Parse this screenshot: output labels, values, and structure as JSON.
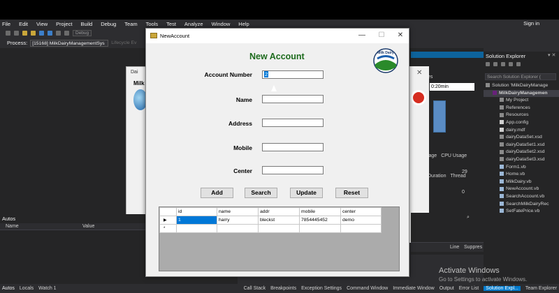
{
  "menu": [
    "File",
    "Edit",
    "View",
    "Project",
    "Build",
    "Debug",
    "Team",
    "Tools",
    "Test",
    "Analyze",
    "Window",
    "Help"
  ],
  "sign_in": "Sign in",
  "toolbar": {
    "debug_combo": "Debug"
  },
  "process": {
    "label": "Process:",
    "value": "[15168] MilkDairyManagementSys",
    "lifecycle": "Lifecycle Ev"
  },
  "bg_dialog": {
    "title": "Dai",
    "header": "Milk"
  },
  "diagnostics": {
    "time": "0:20min",
    "tes_label": "tes",
    "value_29": "29",
    "value_0": "0",
    "tabs": [
      "sage",
      "CPU Usage"
    ],
    "sub_tabs": [
      "Duration",
      "Thread"
    ]
  },
  "autos": {
    "title": "Autos",
    "col_name": "Name",
    "col_value": "Value"
  },
  "solution_explorer": {
    "title": "Solution Explorer",
    "search_placeholder": "Search Solution Explorer (",
    "items": [
      {
        "label": "Solution 'MilkDairyManage",
        "icon": "solution-icon",
        "level": 0
      },
      {
        "label": "MilkDairyManagemen",
        "icon": "project-icon",
        "level": 1,
        "selected": true
      },
      {
        "label": "My Project",
        "icon": "wrench-icon",
        "level": 2
      },
      {
        "label": "References",
        "icon": "references-icon",
        "level": 2
      },
      {
        "label": "Resources",
        "icon": "folder-icon",
        "level": 2
      },
      {
        "label": "App.config",
        "icon": "config-icon",
        "level": 2
      },
      {
        "label": "dairy.mdf",
        "icon": "database-icon",
        "level": 2
      },
      {
        "label": "dairyDataSet.xsd",
        "icon": "dataset-icon",
        "level": 2
      },
      {
        "label": "dairyDataSet1.xsd",
        "icon": "dataset-icon",
        "level": 2
      },
      {
        "label": "dairyDataSet2.xsd",
        "icon": "dataset-icon",
        "level": 2
      },
      {
        "label": "dairyDataSet3.xsd",
        "icon": "dataset-icon",
        "level": 2
      },
      {
        "label": "Form1.vb",
        "icon": "form-icon",
        "level": 2
      },
      {
        "label": "Home.vb",
        "icon": "form-icon",
        "level": 2
      },
      {
        "label": "MilkDairy.vb",
        "icon": "form-icon",
        "level": 2
      },
      {
        "label": "NewAccount.vb",
        "icon": "form-icon",
        "level": 2
      },
      {
        "label": "SearchAccount.vb",
        "icon": "form-icon",
        "level": 2
      },
      {
        "label": "SearchMilkDairyRec",
        "icon": "form-icon",
        "level": 2
      },
      {
        "label": "SetFatePrice.vb",
        "icon": "form-icon",
        "level": 2
      }
    ]
  },
  "bottom_panel": {
    "line": "Line",
    "suppress": "Suppres"
  },
  "status_tabs_left": [
    "Autos",
    "Locals",
    "Watch 1"
  ],
  "status_tabs_right": [
    "Call Stack",
    "Breakpoints",
    "Exception Settings",
    "Command Window",
    "Immediate Window",
    "Output",
    "Error List",
    "Solution Expl...",
    "Team Explorer"
  ],
  "activate": {
    "line1": "Activate Windows",
    "line2": "Go to Settings to activate Windows."
  },
  "new_account": {
    "window_title": "NewAccount",
    "heading": "New Account",
    "logo_text": "Milk Dairy",
    "fields": {
      "account_number": {
        "label": "Account Number",
        "value": "2"
      },
      "name": {
        "label": "Name",
        "value": ""
      },
      "address": {
        "label": "Address",
        "value": ""
      },
      "mobile": {
        "label": "Mobile",
        "value": ""
      },
      "center": {
        "label": "Center",
        "value": ""
      }
    },
    "buttons": {
      "add": "Add",
      "search": "Search",
      "update": "Update",
      "reset": "Reset"
    },
    "grid": {
      "columns": [
        "id",
        "name",
        "addr",
        "mobile",
        "center"
      ],
      "rows": [
        {
          "marker": "▶",
          "cells": [
            "1",
            "harry",
            "bleckst",
            "7854445452",
            "demo"
          ]
        },
        {
          "marker": "*",
          "cells": [
            "",
            "",
            "",
            "",
            ""
          ]
        }
      ]
    }
  }
}
